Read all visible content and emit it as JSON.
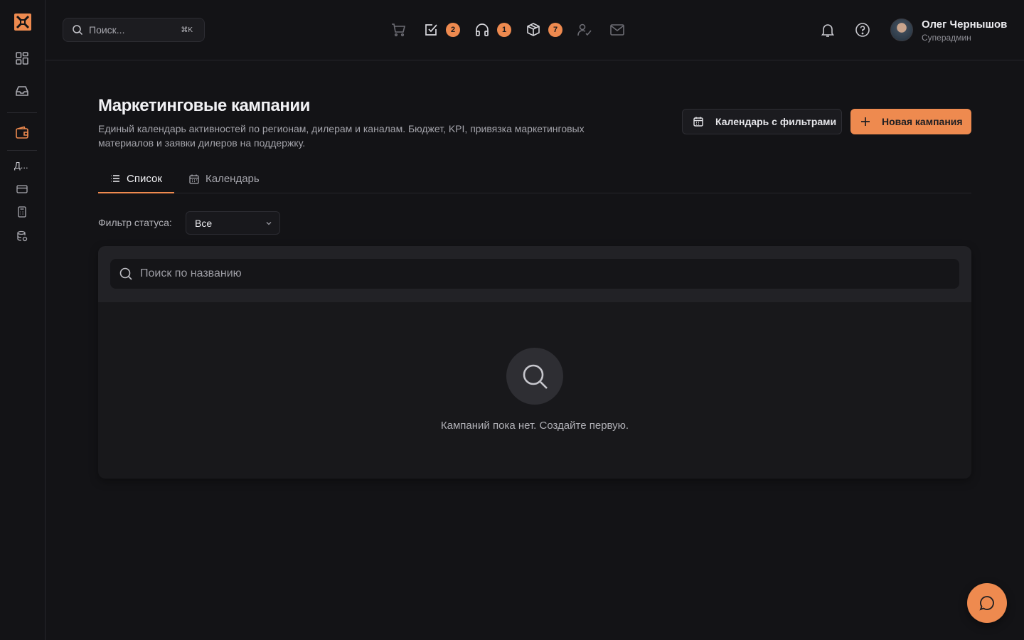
{
  "search": {
    "placeholder": "Поиск...",
    "shortcut": "⌘K"
  },
  "header": {
    "icons": [
      {
        "name": "cart-icon"
      },
      {
        "name": "tasks-icon",
        "badge": "2"
      },
      {
        "name": "headset-icon",
        "badge": "1"
      },
      {
        "name": "package-icon",
        "badge": "7"
      },
      {
        "name": "user-check-icon"
      },
      {
        "name": "mail-icon"
      }
    ],
    "user": {
      "name": "Олег Чернышов",
      "role": "Суперадмин"
    }
  },
  "sidebar": {
    "collapsed_label": "Д..."
  },
  "page": {
    "title": "Маркетинговые кампании",
    "description": "Единый календарь активностей по регионам, дилерам и каналам. Бюджет, KPI, привязка маркетинговых материалов и заявки дилеров на поддержку.",
    "calendar_button": "Календарь с фильтрами",
    "new_button": "Новая кампания",
    "tabs": [
      {
        "label": "Список",
        "active": true
      },
      {
        "label": "Календарь",
        "active": false
      }
    ],
    "filter": {
      "label": "Фильтр статуса:",
      "value": "Все"
    },
    "table_search_placeholder": "Поиск по названию",
    "empty_text": "Кампаний пока нет. Создайте первую."
  },
  "colors": {
    "accent": "#ee8a4f",
    "background": "#131316",
    "panel": "#18181b"
  }
}
